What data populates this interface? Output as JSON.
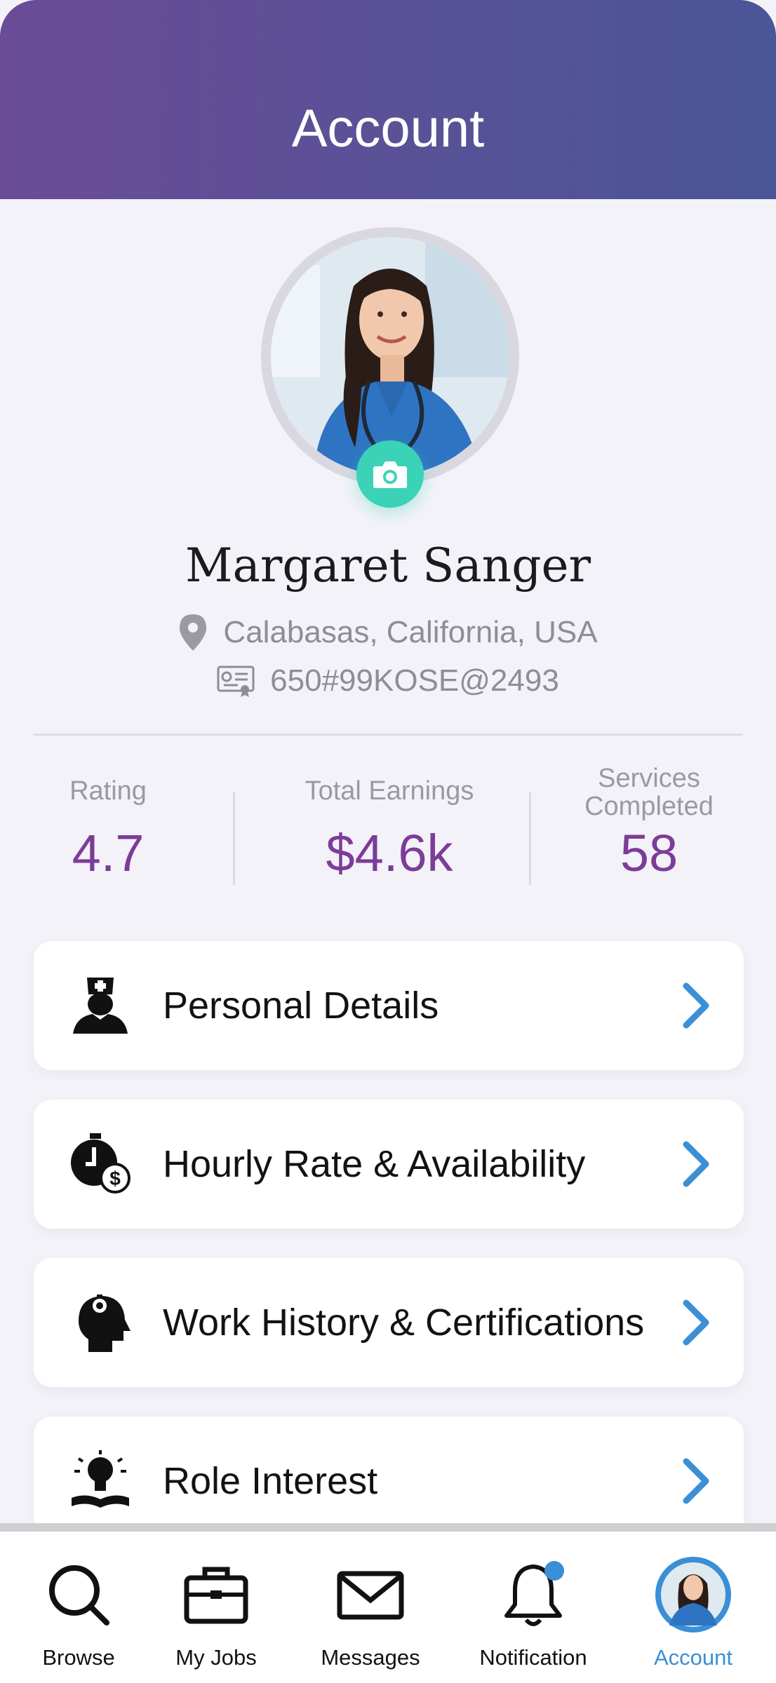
{
  "header": {
    "title": "Account"
  },
  "profile": {
    "name": "Margaret Sanger",
    "location": "Calabasas, California, USA",
    "license": "650#99KOSE@2493"
  },
  "stats": [
    {
      "label": "Rating",
      "value": "4.7"
    },
    {
      "label": "Total Earnings",
      "value": "$4.6k"
    },
    {
      "label_line1": "Services",
      "label_line2": "Completed",
      "value": "58"
    }
  ],
  "menu": [
    {
      "label": "Personal Details",
      "icon": "nurse-icon"
    },
    {
      "label": "Hourly Rate & Availability",
      "icon": "clock-dollar-icon"
    },
    {
      "label": "Work History & Certifications",
      "icon": "head-gear-icon"
    },
    {
      "label": "Role Interest",
      "icon": "lightbulb-book-icon"
    }
  ],
  "nav": [
    {
      "label": "Browse",
      "icon": "search-icon"
    },
    {
      "label": "My Jobs",
      "icon": "briefcase-icon"
    },
    {
      "label": "Messages",
      "icon": "envelope-icon"
    },
    {
      "label": "Notification",
      "icon": "bell-icon",
      "badge": true
    },
    {
      "label": "Account",
      "icon": "avatar-icon",
      "active": true
    }
  ],
  "colors": {
    "header_start": "#6a4c96",
    "header_end": "#4a5697",
    "accent_purple": "#7d3c98",
    "chevron_blue": "#3a8fd6",
    "camera_teal": "#3bd3b7"
  }
}
